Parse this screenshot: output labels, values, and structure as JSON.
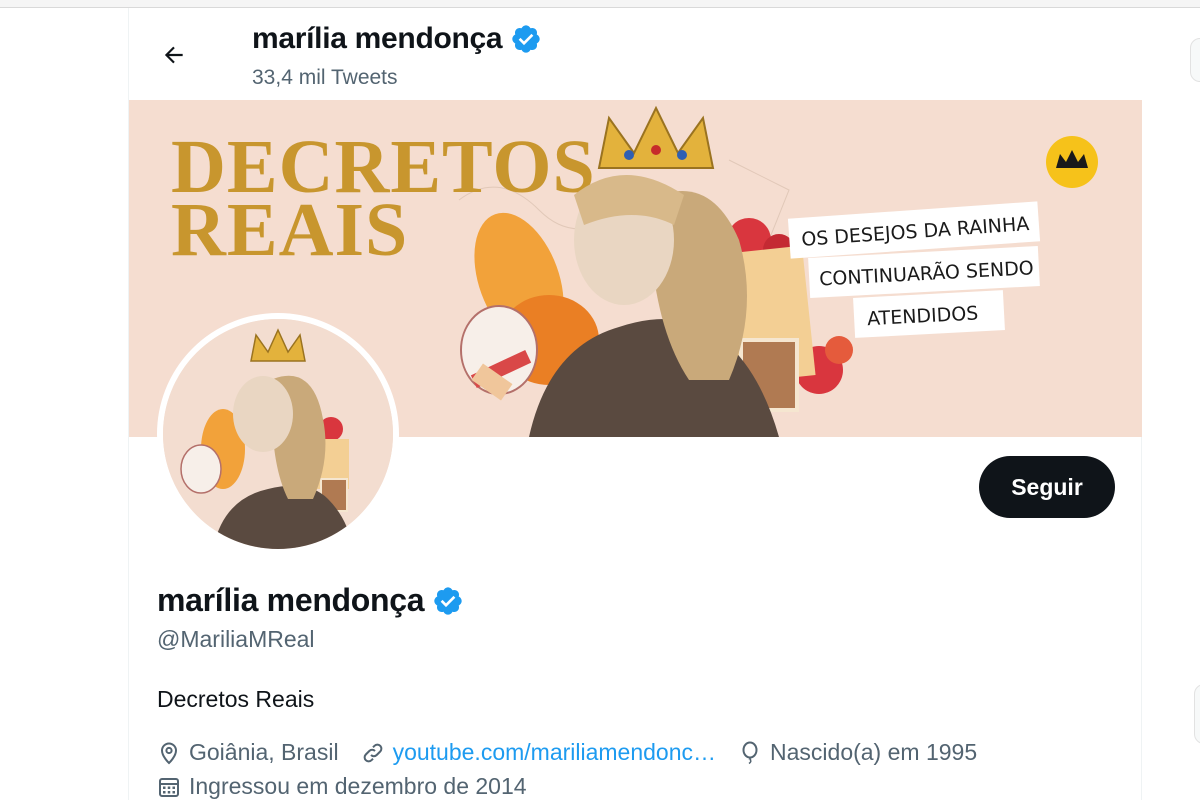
{
  "header": {
    "name": "marília mendonça",
    "tweet_count": "33,4 mil Tweets"
  },
  "banner": {
    "title_line1": "DECRETOS",
    "title_line2": "REAIS",
    "tagline": [
      "OS DESEJOS DA RAINHA",
      "CONTINUARÃO SENDO",
      "ATENDIDOS"
    ]
  },
  "profile": {
    "name": "marília mendonça",
    "handle": "@MariliaMReal",
    "bio": "Decretos Reais",
    "location": "Goiânia, Brasil",
    "website": "youtube.com/mariliamendonc…",
    "birth": "Nascido(a) em 1995",
    "joined": "Ingressou em dezembro de 2014"
  },
  "actions": {
    "follow_label": "Seguir"
  },
  "colors": {
    "verified": "#1d9bf0",
    "link": "#1d9bf0",
    "secondary_text": "#536471",
    "banner_bg": "#f5ddd0",
    "banner_title": "#c8962e"
  },
  "icons": {
    "back": "arrow-left-icon",
    "verified": "verified-badge-icon",
    "location": "location-pin-icon",
    "link": "link-icon",
    "birthday": "balloon-icon",
    "calendar": "calendar-icon"
  }
}
